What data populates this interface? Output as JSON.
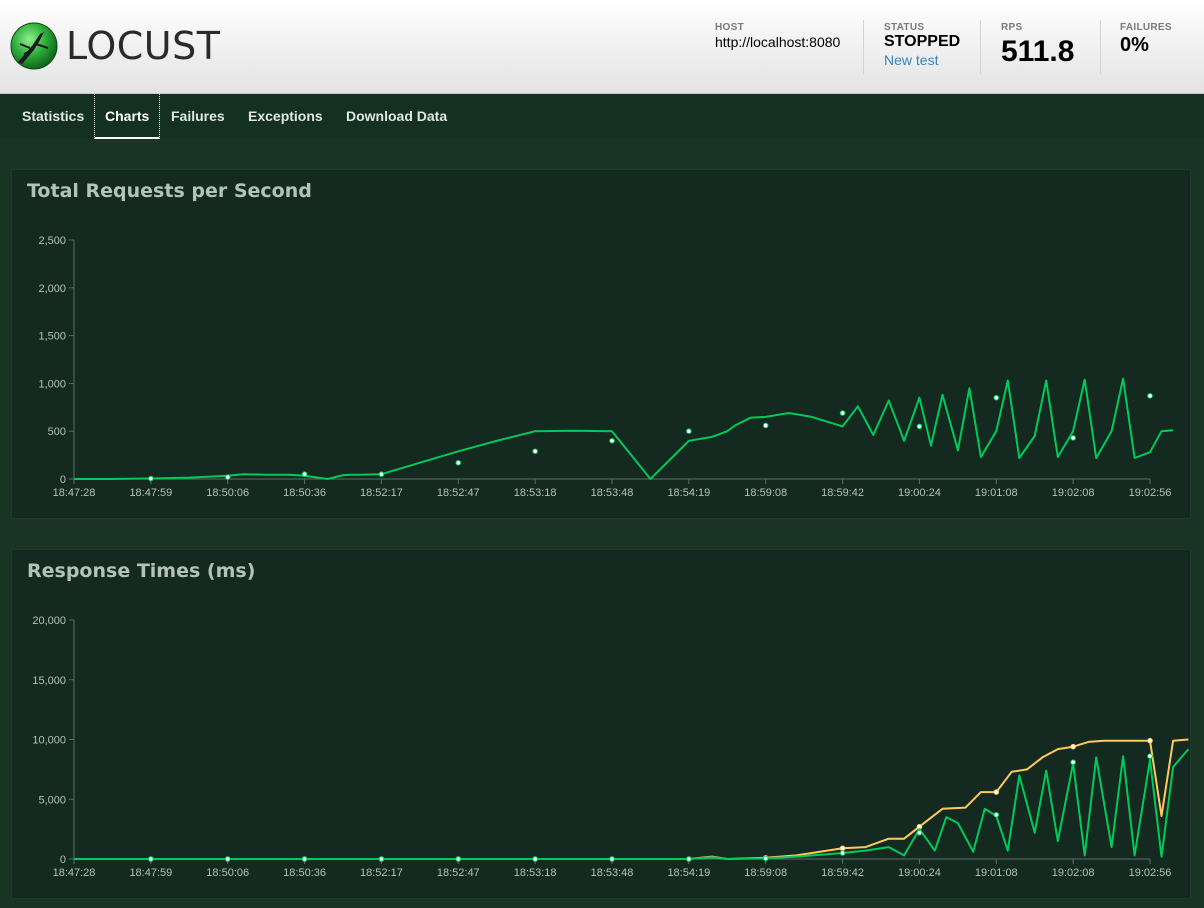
{
  "header": {
    "brand": "LOCUST",
    "host": {
      "label": "HOST",
      "value": "http://localhost:8080"
    },
    "status": {
      "label": "STATUS",
      "value": "STOPPED",
      "link": "New test"
    },
    "rps": {
      "label": "RPS",
      "value": "511.8"
    },
    "failures": {
      "label": "FAILURES",
      "value": "0%"
    }
  },
  "nav": {
    "tabs": [
      {
        "label": "Statistics",
        "active": false
      },
      {
        "label": "Charts",
        "active": true
      },
      {
        "label": "Failures",
        "active": false
      },
      {
        "label": "Exceptions",
        "active": false
      },
      {
        "label": "Download Data",
        "active": false
      }
    ]
  },
  "colors": {
    "green": "#00ca5a",
    "yellow": "#ffca5a",
    "panel": "#142920"
  },
  "chart_data": [
    {
      "type": "line",
      "title": "Total Requests per Second",
      "x_tick_labels": [
        "18:47:28",
        "18:47:59",
        "18:50:06",
        "18:50:36",
        "18:52:17",
        "18:52:47",
        "18:53:18",
        "18:53:48",
        "18:54:19",
        "18:59:08",
        "18:59:42",
        "19:00:24",
        "19:01:08",
        "19:02:08",
        "19:02:56"
      ],
      "ylim": [
        0,
        2500
      ],
      "y_ticks": [
        0,
        500,
        1000,
        1500,
        2000,
        2500
      ],
      "y_tick_labels": [
        "0",
        "500",
        "1,000",
        "1,500",
        "2,000",
        "2,500"
      ],
      "grid": false,
      "series": [
        {
          "color": "#00ca5a",
          "x": [
            0,
            0.5,
            1,
            1.5,
            2,
            2.2,
            2.5,
            2.8,
            3,
            3.3,
            3.5,
            3.6,
            3.7,
            4,
            4.5,
            5,
            5.5,
            6,
            6.5,
            7,
            7.5,
            8,
            8.3,
            8.5,
            8.6,
            8.7,
            8.8,
            9,
            9.3,
            9.6,
            10,
            10.2,
            10.4,
            10.6,
            10.8,
            11,
            11.15,
            11.3,
            11.5,
            11.65,
            11.8,
            12,
            12.15,
            12.3,
            12.5,
            12.65,
            12.8,
            13,
            13.15,
            13.3,
            13.5,
            13.65,
            13.8,
            14,
            14.15,
            14.3
          ],
          "y": [
            0,
            0,
            5,
            15,
            35,
            50,
            45,
            45,
            35,
            0,
            40,
            45,
            45,
            50,
            170,
            290,
            400,
            500,
            505,
            500,
            0,
            400,
            440,
            500,
            560,
            600,
            640,
            650,
            690,
            650,
            550,
            760,
            460,
            820,
            400,
            850,
            350,
            880,
            300,
            950,
            230,
            500,
            1030,
            220,
            450,
            1030,
            230,
            500,
            1040,
            220,
            500,
            1050,
            220,
            280,
            500,
            510
          ],
          "markers_x": [
            1,
            2,
            3,
            4,
            5,
            6,
            7,
            8,
            9,
            10,
            11,
            12,
            13,
            14
          ],
          "markers_y": [
            5,
            20,
            50,
            50,
            170,
            290,
            400,
            500,
            560,
            690,
            550,
            850,
            430,
            870
          ]
        }
      ]
    },
    {
      "type": "line",
      "title": "Response Times (ms)",
      "x_tick_labels": [
        "18:47:28",
        "18:47:59",
        "18:50:06",
        "18:50:36",
        "18:52:17",
        "18:52:47",
        "18:53:18",
        "18:53:48",
        "18:54:19",
        "18:59:08",
        "18:59:42",
        "19:00:24",
        "19:01:08",
        "19:02:08",
        "19:02:56"
      ],
      "ylim": [
        0,
        20000
      ],
      "y_ticks": [
        0,
        5000,
        10000,
        15000,
        20000
      ],
      "y_tick_labels": [
        "0",
        "5,000",
        "10,000",
        "15,000",
        "20,000"
      ],
      "grid": false,
      "series": [
        {
          "color": "#ffca5a",
          "x": [
            0,
            1,
            2,
            3,
            4,
            5,
            6,
            7,
            8,
            8.3,
            8.5,
            9,
            9.4,
            9.8,
            10,
            10.3,
            10.6,
            10.8,
            11,
            11.3,
            11.6,
            11.8,
            12,
            12.2,
            12.4,
            12.6,
            12.8,
            13,
            13.2,
            13.4,
            13.6,
            13.8,
            14,
            14.15,
            14.3,
            14.5
          ],
          "y": [
            0,
            0,
            0,
            0,
            0,
            0,
            0,
            0,
            0,
            200,
            0,
            100,
            300,
            700,
            900,
            1000,
            1700,
            1700,
            2700,
            4200,
            4300,
            5600,
            5600,
            7300,
            7500,
            8500,
            9200,
            9400,
            9800,
            9900,
            9900,
            9900,
            9900,
            3600,
            9900,
            10000
          ],
          "markers_x": [
            1,
            2,
            3,
            4,
            5,
            6,
            7,
            8,
            9,
            10,
            11,
            12,
            13,
            14
          ],
          "markers_y": [
            0,
            0,
            0,
            0,
            0,
            0,
            0,
            0,
            100,
            900,
            2700,
            5600,
            9400,
            9900
          ]
        },
        {
          "color": "#00ca5a",
          "x": [
            0,
            1,
            2,
            3,
            4,
            5,
            6,
            7,
            8,
            8.3,
            8.5,
            9,
            9.4,
            9.8,
            10,
            10.3,
            10.6,
            10.8,
            11,
            11.2,
            11.35,
            11.5,
            11.7,
            11.85,
            12,
            12.15,
            12.3,
            12.5,
            12.65,
            12.8,
            13,
            13.15,
            13.3,
            13.5,
            13.65,
            13.8,
            14,
            14.15,
            14.3,
            14.5
          ],
          "y": [
            0,
            0,
            0,
            0,
            0,
            0,
            0,
            0,
            0,
            150,
            0,
            50,
            200,
            400,
            500,
            700,
            1000,
            300,
            2500,
            700,
            3500,
            3000,
            600,
            4200,
            3600,
            700,
            7000,
            2200,
            7400,
            1500,
            8000,
            300,
            8500,
            1000,
            8600,
            300,
            8300,
            200,
            7700,
            9200
          ],
          "markers_x": [
            1,
            2,
            3,
            4,
            5,
            6,
            7,
            8,
            9,
            10,
            11,
            12,
            13,
            14
          ],
          "markers_y": [
            0,
            0,
            0,
            0,
            0,
            0,
            0,
            0,
            50,
            500,
            2200,
            3700,
            8100,
            8600
          ]
        }
      ]
    }
  ]
}
